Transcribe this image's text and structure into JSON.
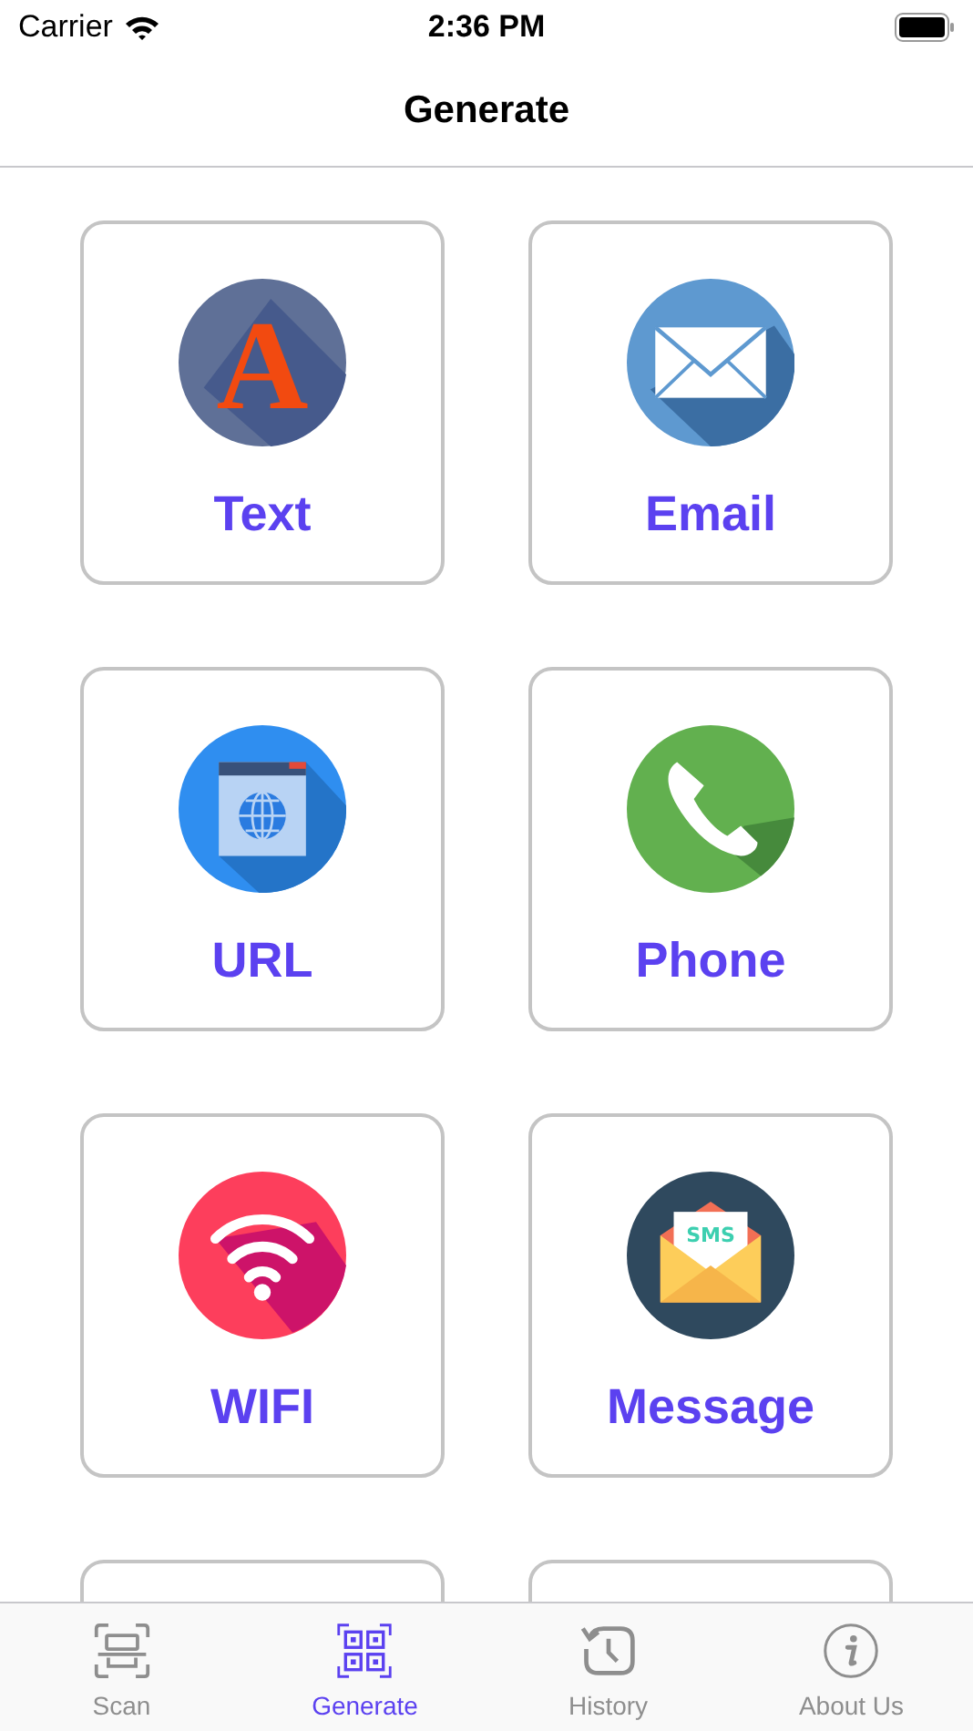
{
  "status_bar": {
    "carrier": "Carrier",
    "time": "2:36 PM"
  },
  "nav_bar": {
    "title": "Generate"
  },
  "icon_glyphs": [
    "A",
    "SMS"
  ],
  "cards": [
    {
      "kind": "text",
      "label": "Text"
    },
    {
      "kind": "email",
      "label": "Email"
    },
    {
      "kind": "url",
      "label": "URL"
    },
    {
      "kind": "phone",
      "label": "Phone"
    },
    {
      "kind": "wifi",
      "label": "WIFI"
    },
    {
      "kind": "message",
      "label": "Message"
    },
    {
      "kind": "cut"
    },
    {
      "kind": "cut"
    }
  ],
  "tab_bar": [
    {
      "kind": "scan",
      "label": "Scan",
      "selected": false
    },
    {
      "kind": "generate",
      "label": "Generate",
      "selected": true
    },
    {
      "kind": "history",
      "label": "History",
      "selected": false
    },
    {
      "kind": "about",
      "label": "About Us",
      "selected": false
    }
  ]
}
